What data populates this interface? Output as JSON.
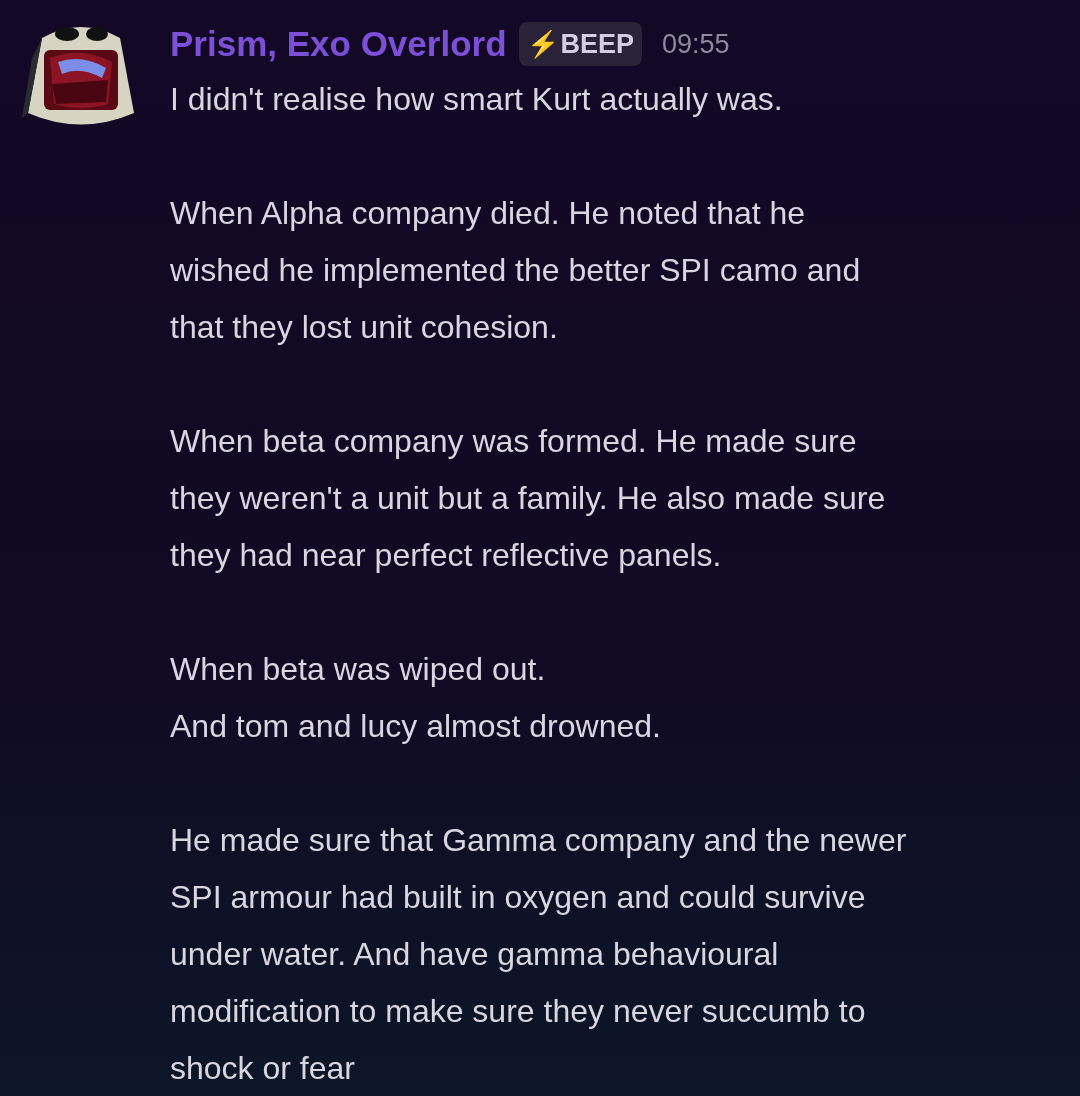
{
  "message": {
    "author": "Prism, Exo Overlord",
    "badge": {
      "icon": "⚡",
      "label": "BEEP"
    },
    "time": "09:55",
    "paragraphs": [
      [
        "I didn't realise how smart Kurt actually was."
      ],
      [
        "When Alpha company died. He noted that he",
        "wished he implemented the better SPI camo and",
        "that they lost unit cohesion."
      ],
      [
        "When beta company was formed. He made sure",
        "they weren't a unit but a family. He also made sure",
        "they had near perfect reflective panels."
      ],
      [
        "When beta was wiped out.",
        "And tom and lucy almost drowned."
      ],
      [
        "He made sure that Gamma company and the newer",
        "SPI armour had built in oxygen and could survive",
        "under water. And have gamma behavioural",
        "modification to make sure they never succumb to",
        "shock or fear"
      ]
    ]
  }
}
